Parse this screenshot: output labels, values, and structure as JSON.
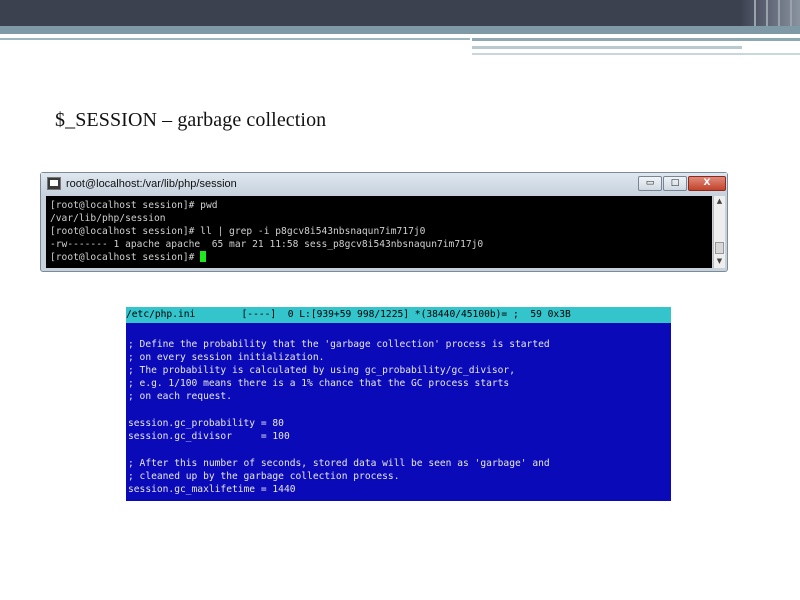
{
  "slide": {
    "title": "$_SESSION – garbage collection"
  },
  "putty": {
    "window_title": "root@localhost:/var/lib/php/session",
    "buttons": {
      "minimize": "▭",
      "maximize": "□",
      "close": "X"
    },
    "lines": [
      "[root@localhost session]# pwd",
      "/var/lib/php/session",
      "[root@localhost session]# ll | grep -i p8gcv8i543nbsnaqun7im717j0",
      "-rw------- 1 apache apache  65 mar 21 11:58 sess_p8gcv8i543nbsnaqun7im717j0",
      "[root@localhost session]# "
    ]
  },
  "editor": {
    "status_line": "/etc/php.ini        [----]  0 L:[939+59 998/1225] *(38440/45100b)= ;  59 0x3B",
    "lines": [
      "; Define the probability that the 'garbage collection' process is started",
      "; on every session initialization.",
      "; The probability is calculated by using gc_probability/gc_divisor,",
      "; e.g. 1/100 means there is a 1% chance that the GC process starts",
      "; on each request.",
      "",
      "session.gc_probability = 80",
      "session.gc_divisor     = 100",
      "",
      "; After this number of seconds, stored data will be seen as 'garbage' and",
      "; cleaned up by the garbage collection process.",
      "session.gc_maxlifetime = 1440"
    ]
  },
  "colors": {
    "banner_dark": "#3c4150",
    "terminal_bg": "#000000",
    "cursor": "#1ee81e",
    "editor_bg": "#0a0ab8",
    "editor_status_bg": "#33c4cc"
  }
}
